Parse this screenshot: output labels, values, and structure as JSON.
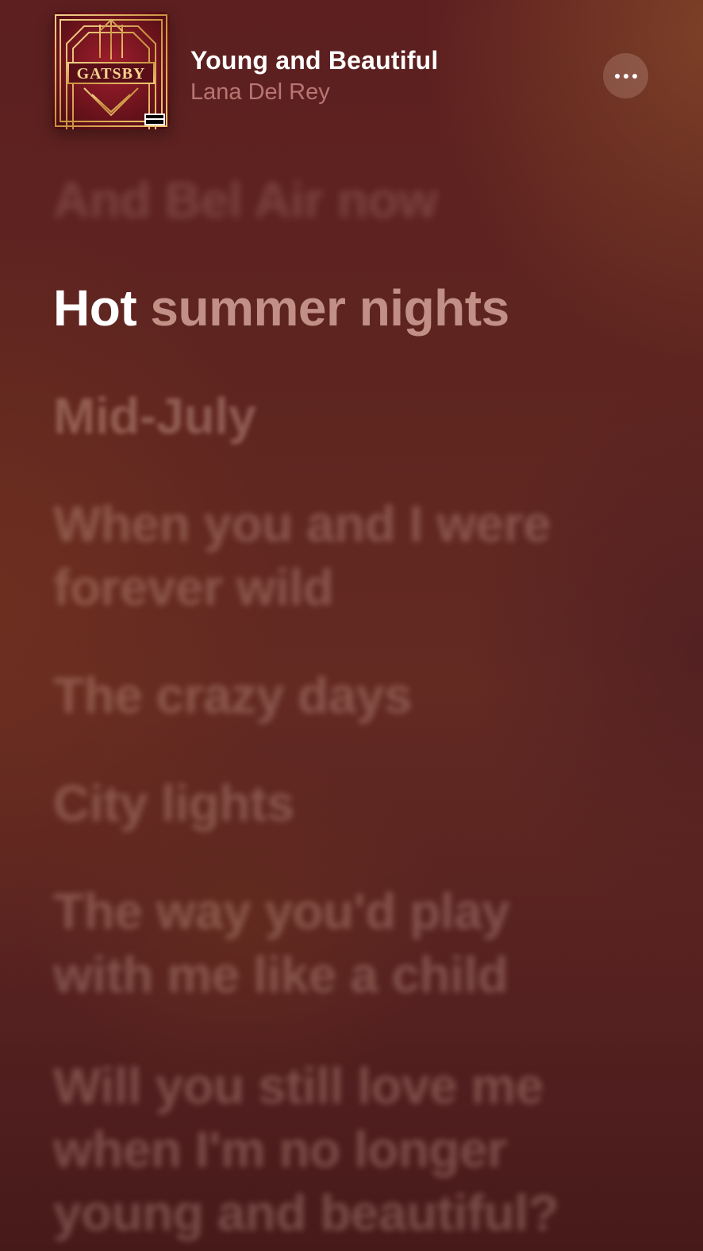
{
  "now_playing": {
    "title": "Young and Beautiful",
    "artist": "Lana Del Rey",
    "artwork": {
      "label": "GATSBY",
      "badge": "PARENTAL ADVISORY EXPLICIT CONTENT",
      "icon": "album-artwork-art-deco"
    },
    "more_icon": "ellipsis-icon"
  },
  "lyrics": {
    "previous": [
      "And Bel Air now"
    ],
    "current": {
      "sung": "Hot",
      "remaining": "summer nights"
    },
    "upcoming": [
      "Mid-July",
      "When you and I were forever wild",
      "The crazy days",
      "City lights",
      "The way you'd play with me like a child",
      "Will you still love me when I'm no longer young and beautiful?"
    ]
  },
  "colors": {
    "background": "#5e2520",
    "active_lyric": "#ffffff",
    "artist_text": "#e8a19c"
  }
}
